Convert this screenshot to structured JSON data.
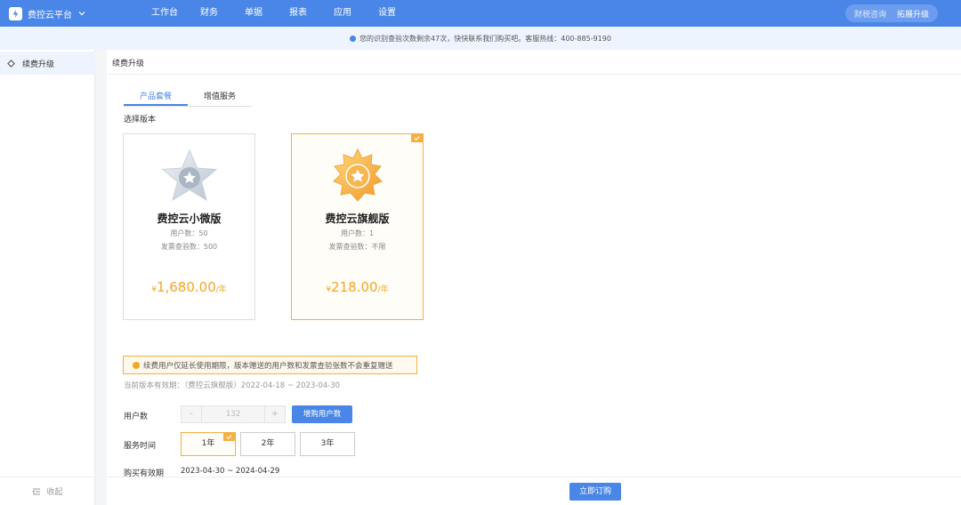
{
  "app": {
    "name": "费控云平台"
  },
  "nav": [
    "工作台",
    "财务",
    "单据",
    "报表",
    "应用",
    "设置"
  ],
  "top_actions": {
    "consult": "财税咨询",
    "upgrade": "拓展升级"
  },
  "notice": "您的识别查验次数剩余47次，快快联系我们购买吧。客服热线：400-885-9190",
  "sidebar": {
    "item": "续费升级",
    "collapse": "收起"
  },
  "breadcrumb": "续费升级",
  "tabs": [
    "产品套餐",
    "增值服务"
  ],
  "section_label": "选择版本",
  "plans": [
    {
      "name": "费控云小微版",
      "users": "用户数：50",
      "checks": "发票查验数：500",
      "currency": "¥",
      "price": "1,680.00",
      "unit": "/年",
      "selected": false
    },
    {
      "name": "费控云旗舰版",
      "users": "用户数：1",
      "checks": "发票查验数：不限",
      "currency": "¥",
      "price": "218.00",
      "unit": "/年",
      "selected": true
    }
  ],
  "warning": "续费用户仅延长使用期限，版本赠送的用户数和发票查验张数不会重复赠送",
  "current_validity": "当前版本有效期：（费控云旗舰版）2022-04-18 ~ 2023-04-30",
  "users_row": {
    "label": "用户数",
    "minus": "-",
    "value": "132",
    "plus": "+",
    "add_button": "增购用户数"
  },
  "service_row": {
    "label": "服务时间",
    "options": [
      "1年",
      "2年",
      "3年"
    ],
    "selected_index": 0
  },
  "purchase_row": {
    "label": "购买有效期",
    "value": "2023-04-30 ~ 2024-04-29"
  },
  "buy_button": "立即订购",
  "colors": {
    "primary": "#4a86e8",
    "accent": "#f5b041",
    "price": "#f5a623"
  }
}
